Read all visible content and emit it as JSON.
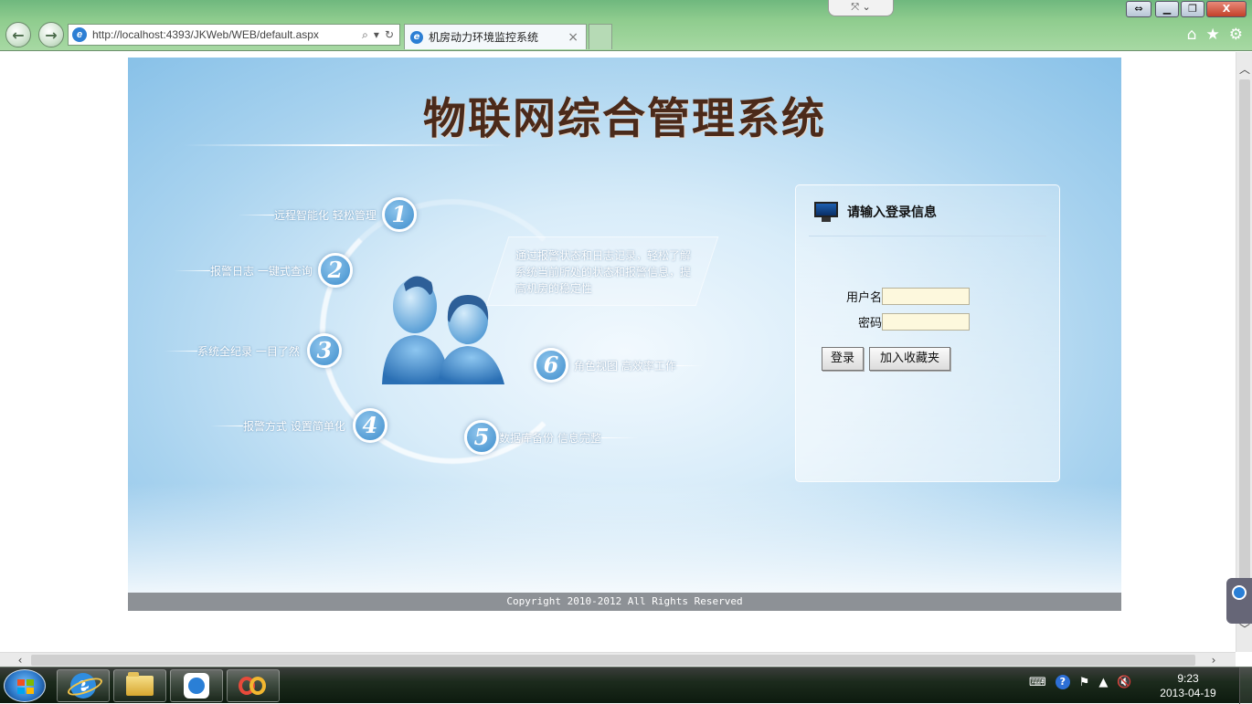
{
  "browser": {
    "url": "http://localhost:4393/JKWeb/WEB/default.aspx",
    "tab_title": "机房动力环境监控系统",
    "tab_close": "×",
    "back": "←",
    "forward": "→",
    "search_icon": "⌕",
    "dropdown_icon": "▾",
    "refresh_icon": "↻",
    "compat_icon": "⇔",
    "top_pill": "⤧ ⌄",
    "home_icon": "⌂",
    "star_icon": "★",
    "gear_icon": "⚙",
    "minimize": "▁",
    "maximize": "❐",
    "close": "X"
  },
  "page": {
    "system_title": "物联网综合管理系统",
    "features": [
      {
        "num": "1",
        "text": "远程智能化 轻松管理"
      },
      {
        "num": "2",
        "text": "报警日志 一键式查询"
      },
      {
        "num": "3",
        "text": "系统全纪录 一目了然"
      },
      {
        "num": "4",
        "text": "报警方式 设置简单化"
      },
      {
        "num": "5",
        "text": "数据库备份 信息完整"
      },
      {
        "num": "6",
        "text": "角色视图 高效率工作"
      }
    ],
    "callout": "通过报警状态和日志记录，轻松了解系统当前所处的状态和报警信息，提高机房的稳定性",
    "login": {
      "title": "请输入登录信息",
      "username_label": "用户名",
      "username_value": "",
      "password_label": "密码",
      "password_value": "",
      "login_button": "登录",
      "favorite_button": "加入收藏夹"
    },
    "footer": "Copyright  2010-2012 All Rights Reserved"
  },
  "scrollbars": {
    "up": "︿",
    "down": "﹀",
    "left": "‹",
    "right": "›"
  },
  "taskbar": {
    "time": "9:23",
    "date": "2013-04-19",
    "tray_keyboard": "⌨",
    "tray_help": "?",
    "tray_flag": "⚑",
    "tray_arrow": "▲",
    "tray_speaker": "🔇"
  },
  "colors": {
    "title_brown": "#4b2a1a",
    "page_blue": "#88c1e8",
    "input_yellow": "#fdf8dd",
    "footer_gray": "#8d9196"
  }
}
